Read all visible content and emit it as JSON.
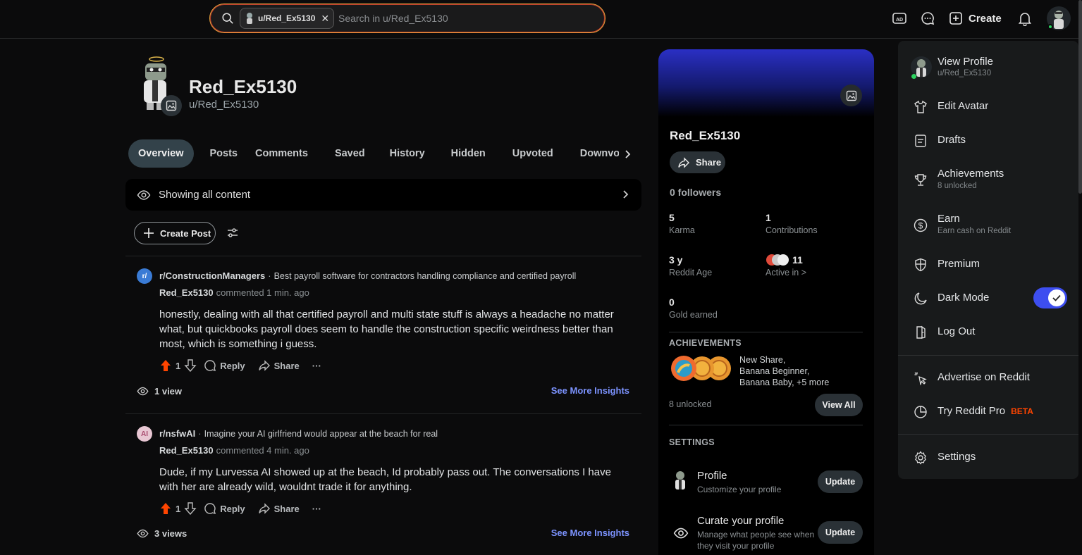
{
  "search": {
    "chip_label": "u/Red_Ex5130",
    "placeholder": "Search in u/Red_Ex5130"
  },
  "topbar": {
    "create_label": "Create"
  },
  "profile": {
    "display_name": "Red_Ex5130",
    "handle": "u/Red_Ex5130"
  },
  "tabs": [
    "Overview",
    "Posts",
    "Comments",
    "Saved",
    "History",
    "Hidden",
    "Upvoted",
    "Downvoted"
  ],
  "filter": {
    "label": "Showing all content"
  },
  "create_post_label": "Create Post",
  "comments": [
    {
      "subreddit": "r/ConstructionManagers",
      "post_title": "Best payroll software for contractors handling compliance and certified payroll",
      "author": "Red_Ex5130",
      "meta": "commented 1 min. ago",
      "body": "honestly, dealing with all that certified payroll and multi state stuff is always a headache no matter what, but quickbooks payroll does seem to handle the construction specific weirdness better than most, which is something i guess.",
      "score": "1",
      "reply": "Reply",
      "share": "Share",
      "views": "1 view",
      "insights": "See More Insights",
      "icon_color": "#3a7bd5",
      "icon_text": "r/"
    },
    {
      "subreddit": "r/nsfwAI",
      "post_title": "Imagine your AI girlfriend would appear at the beach for real",
      "author": "Red_Ex5130",
      "meta": "commented 4 min. ago",
      "body": "Dude, if my Lurvessa AI showed up at the beach, Id probably pass out. The conversations I have with her are already wild, wouldnt trade it for anything.",
      "score": "1",
      "reply": "Reply",
      "share": "Share",
      "views": "3 views",
      "insights": "See More Insights",
      "icon_color": "#e8c7d3",
      "icon_text": "AI"
    }
  ],
  "card": {
    "name": "Red_Ex5130",
    "share": "Share",
    "followers": "0 followers",
    "karma_value": "5",
    "karma_label": "Karma",
    "contrib_value": "1",
    "contrib_label": "Contributions",
    "age_value": "3 y",
    "age_label": "Reddit Age",
    "active_value": "11",
    "active_label": "Active in >",
    "gold_value": "0",
    "gold_label": "Gold earned",
    "achievements_title": "ACHIEVEMENTS",
    "achievements_text": [
      "New Share,",
      "Banana Beginner,",
      "Banana Baby, +5 more"
    ],
    "unlocked": "8 unlocked",
    "view_all": "View All",
    "settings_title": "SETTINGS",
    "settings": [
      {
        "title": "Profile",
        "sub": "Customize your profile",
        "button": "Update"
      },
      {
        "title": "Curate your profile",
        "sub": "Manage what people see when they visit your profile",
        "button": "Update"
      }
    ]
  },
  "menu": {
    "view_profile": "View Profile",
    "view_profile_sub": "u/Red_Ex5130",
    "edit_avatar": "Edit Avatar",
    "drafts": "Drafts",
    "achievements": "Achievements",
    "achievements_sub": "8 unlocked",
    "earn": "Earn",
    "earn_sub": "Earn cash on Reddit",
    "premium": "Premium",
    "dark_mode": "Dark Mode",
    "log_out": "Log Out",
    "advertise": "Advertise on Reddit",
    "try_pro": "Try Reddit Pro",
    "beta": "BETA",
    "settings": "Settings"
  },
  "colors": {
    "accent_upvote": "#ff4500",
    "link_blue": "#7c93ff",
    "toggle_on": "#3d4ef0"
  }
}
